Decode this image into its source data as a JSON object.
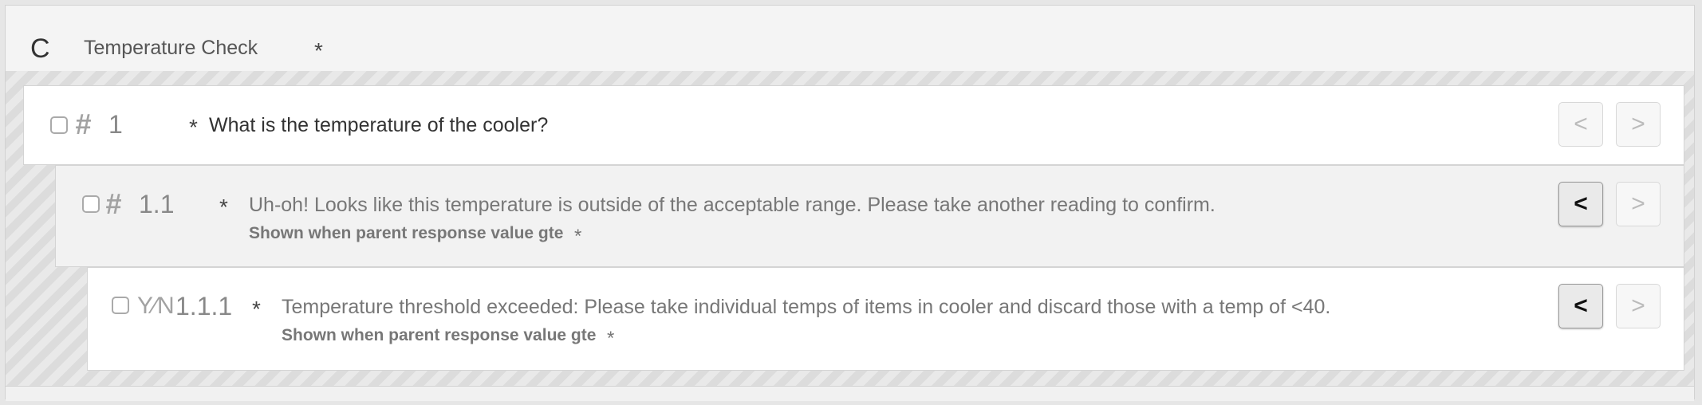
{
  "section": {
    "letter": "C",
    "title": "Temperature Check",
    "required_mark": "*"
  },
  "questions": [
    {
      "number": "1",
      "type_icon": "hash-icon",
      "type_glyph": "#",
      "required_mark": "*",
      "text": "What is the temperature of the cooler?",
      "prev_button": "<",
      "next_button": ">",
      "prev_enabled": false,
      "next_enabled": false
    },
    {
      "number": "1.1",
      "type_icon": "hash-icon",
      "type_glyph": "#",
      "required_mark": "*",
      "text": "Uh-oh! Looks like this temperature is outside of the acceptable range. Please take another reading to confirm.",
      "condition": "Shown when parent response value gte",
      "condition_mark": "*",
      "prev_button": "<",
      "next_button": ">",
      "prev_enabled": true,
      "next_enabled": false
    },
    {
      "number": "1.1.1",
      "type_icon": "yes-no-icon",
      "type_glyph": "Y⁄N",
      "required_mark": "*",
      "text": "Temperature threshold exceeded: Please take individual temps of items in cooler and discard those with a temp of <40.",
      "condition": "Shown when parent response value gte",
      "condition_mark": "*",
      "prev_button": "<",
      "next_button": ">",
      "prev_enabled": true,
      "next_enabled": false
    }
  ]
}
